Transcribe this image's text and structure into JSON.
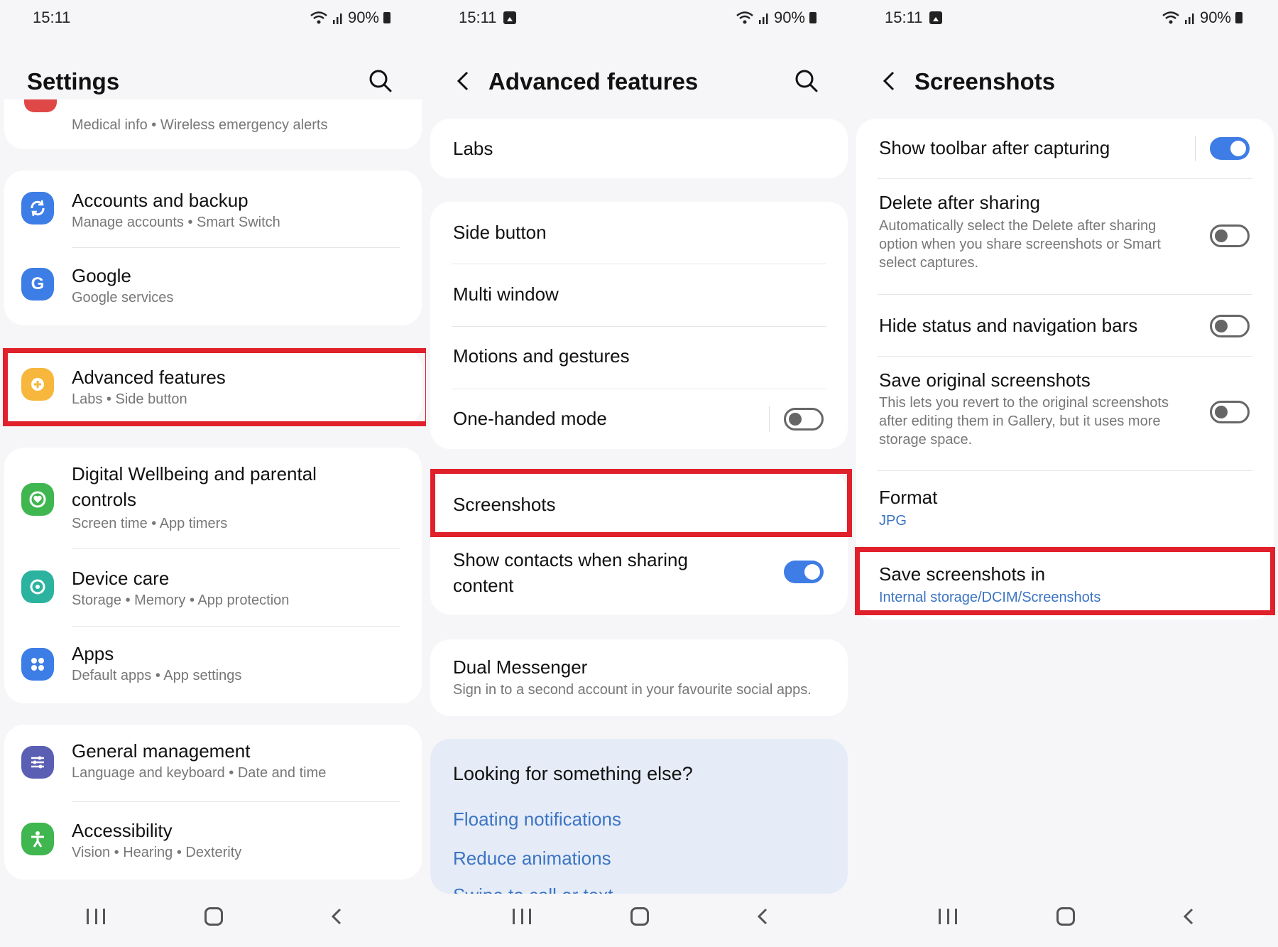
{
  "colors": {
    "accent": "#3e7ce6",
    "highlight": "#e0202a",
    "link": "#3b74c4"
  },
  "status": {
    "time": "15:11",
    "battery": "90%"
  },
  "panel1": {
    "title": "Settings",
    "top_partial_subtitle": "Medical info  •  Wireless emergency alerts",
    "items": [
      {
        "title": "Accounts and backup",
        "subtitle": "Manage accounts  •  Smart Switch",
        "icon": "sync-icon",
        "color": "#3d7de6"
      },
      {
        "title": "Google",
        "subtitle": "Google services",
        "icon": "google-icon",
        "color": "#3d7de6"
      },
      {
        "title": "Advanced features",
        "subtitle": "Labs  •  Side button",
        "icon": "gear-plus-icon",
        "color": "#f6b73c"
      },
      {
        "title": "Digital Wellbeing and parental",
        "title2": "controls",
        "subtitle": "Screen time  •  App timers",
        "icon": "heart-icon",
        "color": "#3fb650"
      },
      {
        "title": "Device care",
        "subtitle": "Storage  •  Memory  •  App protection",
        "icon": "refresh-icon",
        "color": "#2bb3a0"
      },
      {
        "title": "Apps",
        "subtitle": "Default apps  •  App settings",
        "icon": "apps-grid-icon",
        "color": "#3d7de6"
      },
      {
        "title": "General management",
        "subtitle": "Language and keyboard  •  Date and time",
        "icon": "sliders-icon",
        "color": "#5b5fb3"
      },
      {
        "title": "Accessibility",
        "subtitle": "Vision  •  Hearing  •  Dexterity",
        "icon": "person-icon",
        "color": "#3fb650"
      }
    ]
  },
  "panel2": {
    "title": "Advanced features",
    "labs": "Labs",
    "side_button": "Side button",
    "multi_window": "Multi window",
    "motions": "Motions and gestures",
    "one_handed": "One-handed mode",
    "one_handed_on": false,
    "screenshots": "Screenshots",
    "show_contacts": "Show contacts when sharing",
    "show_contacts2": "content",
    "show_contacts_on": true,
    "dual_messenger": "Dual Messenger",
    "dual_messenger_sub": "Sign in to a second account in your favourite social apps.",
    "looking": "Looking for something else?",
    "link1": "Floating notifications",
    "link2": "Reduce animations",
    "link3": "Swipe to call or text"
  },
  "panel3": {
    "title": "Screenshots",
    "toolbar": "Show toolbar after capturing",
    "toolbar_on": true,
    "delete": "Delete after sharing",
    "delete_sub1": "Automatically select the Delete after sharing",
    "delete_sub2": "option when you share screenshots or Smart",
    "delete_sub3": "select captures.",
    "delete_on": false,
    "hide_bars": "Hide status and navigation bars",
    "hide_bars_on": false,
    "save_original": "Save original screenshots",
    "save_original_sub1": "This lets you revert to the original screenshots",
    "save_original_sub2": "after editing them in Gallery, but it uses more",
    "save_original_sub3": "storage space.",
    "save_original_on": false,
    "format": "Format",
    "format_value": "JPG",
    "save_in": "Save screenshots in",
    "save_in_value": "Internal storage/DCIM/Screenshots"
  }
}
